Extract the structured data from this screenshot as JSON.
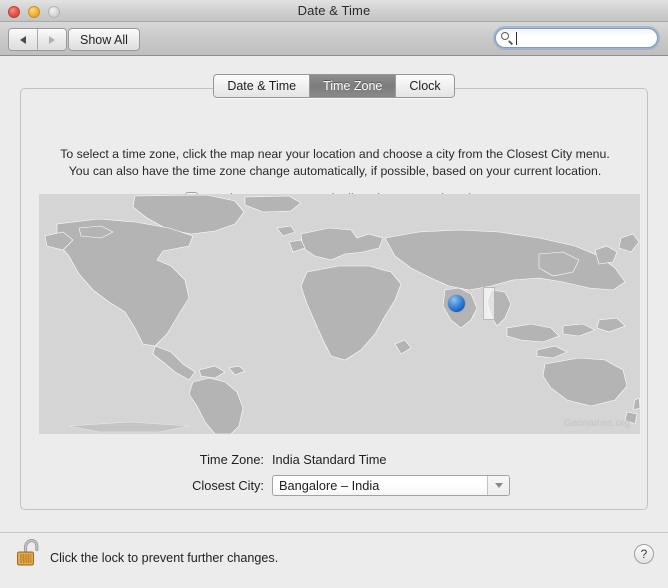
{
  "window": {
    "title": "Date & Time",
    "traffic_lights": [
      "close-button",
      "minimize-button",
      "zoom-button-disabled"
    ]
  },
  "toolbar": {
    "back_icon": "triangle-left-icon",
    "forward_icon": "triangle-right-icon",
    "show_all_label": "Show All",
    "search": {
      "icon": "search-icon",
      "value": "",
      "placeholder": "",
      "focused": true
    }
  },
  "tabs": [
    {
      "label": "Date & Time",
      "active": false
    },
    {
      "label": "Time Zone",
      "active": true
    },
    {
      "label": "Clock",
      "active": false
    }
  ],
  "instructions": {
    "line1": "To select a time zone, click the map near your location and choose a city from the Closest City menu.",
    "line2": "You can also have the time zone change automatically, if possible, based on your current location."
  },
  "auto_timezone": {
    "label": "Set time zone automatically using current location",
    "checked": false
  },
  "map": {
    "watermark": "Geonames.org",
    "marker_icon": "location-pin-marker",
    "highlight_band": "timezone-highlight-band",
    "land_color": "#b4b4b4",
    "ocean_color": "#d5d5d5",
    "marker_color": "#1b62c4"
  },
  "fields": {
    "time_zone_label": "Time Zone:",
    "time_zone_value": "India Standard Time",
    "closest_city_label": "Closest City:",
    "closest_city_value": "Bangalore – India",
    "closest_city_arrow": "chevron-down-icon"
  },
  "footer": {
    "lock_icon": "unlocked-padlock-icon",
    "lock_text": "Click the lock to prevent further changes.",
    "help_label": "?"
  }
}
